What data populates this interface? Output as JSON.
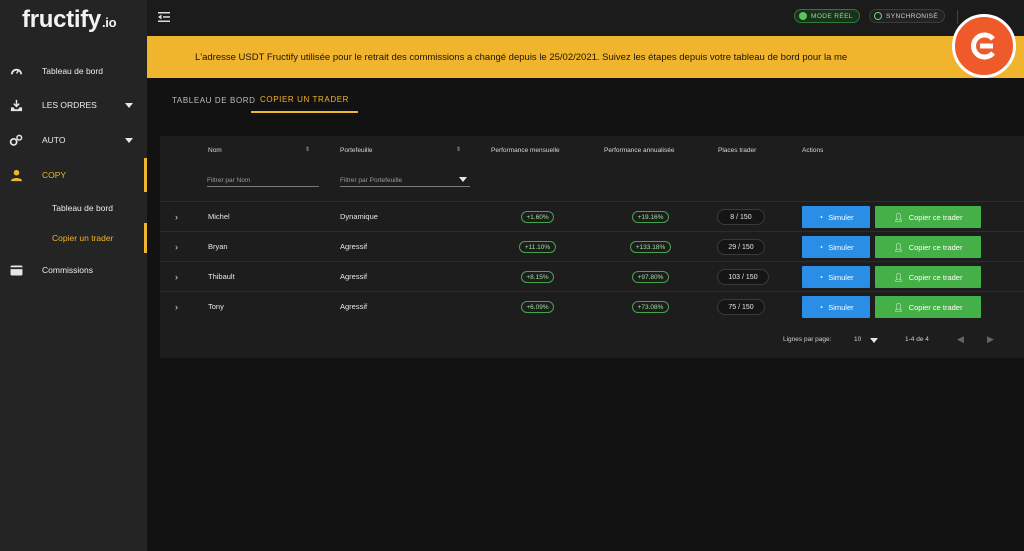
{
  "logo": {
    "name": "fructify",
    "tld": ".io"
  },
  "sidebar": {
    "items": [
      {
        "label": "Tableau de bord",
        "icon": "speedometer-icon"
      },
      {
        "label": "LES ORDRES",
        "icon": "download-tray-icon"
      },
      {
        "label": "AUTO",
        "icon": "gears-icon"
      },
      {
        "label": "COPY",
        "icon": "user-icon"
      },
      {
        "label": "Commissions",
        "icon": "wallet-icon"
      }
    ],
    "copy_sub": [
      {
        "label": "Tableau de bord"
      },
      {
        "label": "Copier un trader"
      }
    ]
  },
  "topbar": {
    "mode": "MODE RÉEL",
    "sync": "SYNCHRONISÉ"
  },
  "banner": {
    "text": "L'adresse USDT Fructify utilisée pour le retrait des commissions a changé depuis le 25/02/2021. Suivez les étapes depuis votre tableau de bord pour la me"
  },
  "tabs": [
    {
      "label": "TABLEAU DE BORD"
    },
    {
      "label": "COPIER UN TRADER"
    }
  ],
  "table": {
    "headers": {
      "name": "Nom",
      "portfolio": "Portefeuille",
      "monthly": "Performance mensuelle",
      "annual": "Performance annualisée",
      "places": "Places trader",
      "actions": "Actions"
    },
    "filters": {
      "name_placeholder": "Filtrer par Nom",
      "portfolio_placeholder": "Filtrer par Portefeuille"
    },
    "rows": [
      {
        "name": "Michel",
        "portfolio": "Dynamique",
        "monthly": "+1.60%",
        "annual": "+19.16%",
        "places": "8 / 150"
      },
      {
        "name": "Bryan",
        "portfolio": "Agressif",
        "monthly": "+11.10%",
        "annual": "+133.18%",
        "places": "29 / 150"
      },
      {
        "name": "Thibault",
        "portfolio": "Agressif",
        "monthly": "+8.15%",
        "annual": "+97.80%",
        "places": "103 / 150"
      },
      {
        "name": "Tony",
        "portfolio": "Agressif",
        "monthly": "+6.09%",
        "annual": "+73.08%",
        "places": "75 / 150"
      }
    ],
    "actions": {
      "simulate": "Simuler",
      "copy": "Copier ce trader"
    },
    "footer": {
      "rows_per_page_label": "Lignes par page:",
      "rows_per_page": "10",
      "range": "1-4 de 4"
    }
  },
  "colors": {
    "accent": "#f0b52d",
    "simulate": "#2a8de6",
    "copy": "#45b048",
    "positive": "#9fe39f"
  }
}
